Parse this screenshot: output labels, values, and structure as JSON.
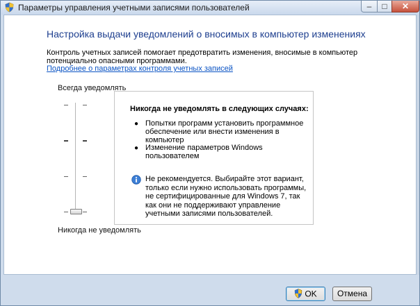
{
  "window": {
    "title": "Параметры управления учетными записями пользователей"
  },
  "main": {
    "heading": "Настройка выдачи уведомлений о вносимых в компьютер изменениях",
    "description": "Контроль учетных записей помогает предотвратить изменения, вносимые в компьютер потенциально опасными программами.",
    "link": "Подробнее о параметрах контроля учетных записей"
  },
  "slider": {
    "top_label": "Всегда уведомлять",
    "bottom_label": "Никогда не уведомлять",
    "level": 0,
    "levels": 4
  },
  "panel": {
    "title": "Никогда не уведомлять в следующих случаях:",
    "items": [
      "Попытки программ установить программное обеспечение или внести изменения в компьютер",
      "Изменение параметров Windows пользователем"
    ],
    "warning": "Не рекомендуется. Выбирайте этот вариант, только если нужно использовать программы, не сертифицированные для Windows 7, так как они не поддерживают управление учетными записями пользователей."
  },
  "buttons": {
    "ok": "OK",
    "cancel": "Отмена"
  },
  "icons": {
    "title": "uac-shield-icon",
    "info": "info-icon",
    "ok": "uac-shield-icon"
  }
}
